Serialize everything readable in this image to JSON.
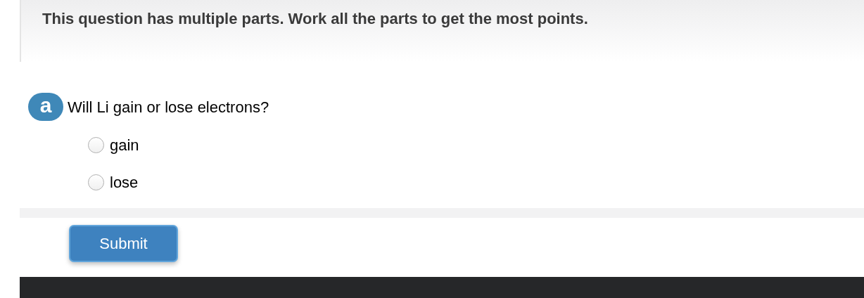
{
  "header": {
    "text": "This question has multiple parts. Work all the parts to get the most points."
  },
  "parts": [
    {
      "badge": "a",
      "question": "Will Li gain or lose electrons?",
      "options": [
        {
          "label": "gain",
          "selected": false
        },
        {
          "label": "lose",
          "selected": false
        }
      ]
    }
  ],
  "submit_button": "Submit"
}
